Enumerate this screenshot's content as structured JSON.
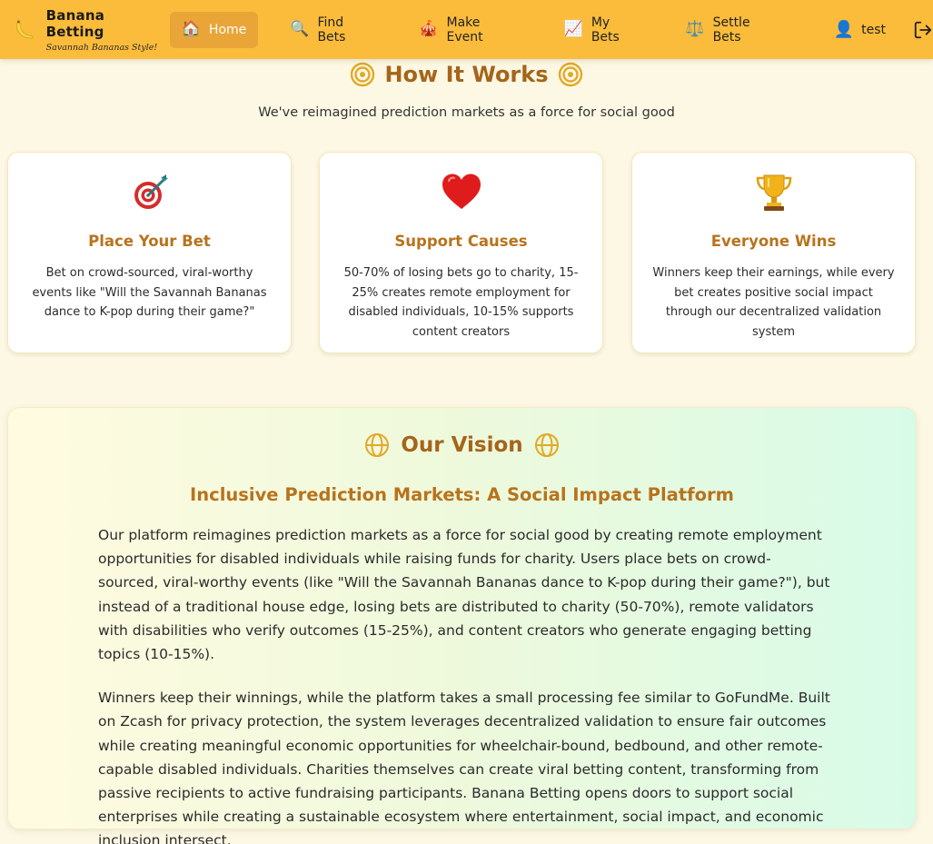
{
  "brand": {
    "title": "Banana Betting",
    "tagline": "Savannah Bananas Style!",
    "logo_icon": "banana-icon"
  },
  "nav": {
    "items": [
      {
        "label": "Home",
        "icon": "🏠",
        "active": true
      },
      {
        "label": "Find Bets",
        "icon": "🔍"
      },
      {
        "label": "Make Event",
        "icon": "🎪"
      },
      {
        "label": "My Bets",
        "icon": "📈"
      },
      {
        "label": "Settle Bets",
        "icon": "⚖️"
      }
    ],
    "user": {
      "name": "test",
      "icon": "👤"
    },
    "logout_icon": "logout-icon"
  },
  "how_it_works": {
    "title": "How It Works",
    "subtitle": "We've reimagined prediction markets as a force for social good",
    "cards": [
      {
        "emoji": "🎯",
        "title": "Place Your Bet",
        "description": "Bet on crowd-sourced, viral-worthy events like \"Will the Savannah Bananas dance to K-pop during their game?\""
      },
      {
        "emoji": "❤️",
        "title": "Support Causes",
        "description": "50-70% of losing bets go to charity, 15-25% creates remote employment for disabled individuals, 10-15% supports content creators"
      },
      {
        "emoji": "🏆",
        "title": "Everyone Wins",
        "description": "Winners keep their earnings, while every bet creates positive social impact through our decentralized validation system"
      }
    ]
  },
  "vision": {
    "title": "Our Vision",
    "subtitle": "Inclusive Prediction Markets: A Social Impact Platform",
    "paragraphs": [
      "Our platform reimagines prediction markets as a force for social good by creating remote employment opportunities for disabled individuals while raising funds for charity. Users place bets on crowd-sourced, viral-worthy events (like \"Will the Savannah Bananas dance to K-pop during their game?\"), but instead of a traditional house edge, losing bets are distributed to charity (50-70%), remote validators with disabilities who verify outcomes (15-25%), and content creators who generate engaging betting topics (10-15%).",
      "Winners keep their winnings, while the platform takes a small processing fee similar to GoFundMe. Built on Zcash for privacy protection, the system leverages decentralized validation to ensure fair outcomes while creating meaningful economic opportunities for wheelchair-bound, bedbound, and other remote-capable disabled individuals. Charities themselves can create viral betting content, transforming from passive recipients to active fundraising participants. Banana Betting opens doors to support social enterprises while creating a sustainable ecosystem where entertainment, social impact, and economic inclusion intersect."
    ]
  },
  "colors": {
    "navbar": "#fbbc3c",
    "nav_active": "#e9a537",
    "heading": "#a5651a",
    "card_title": "#b8731d",
    "page_bg": "#fdf8e4"
  }
}
